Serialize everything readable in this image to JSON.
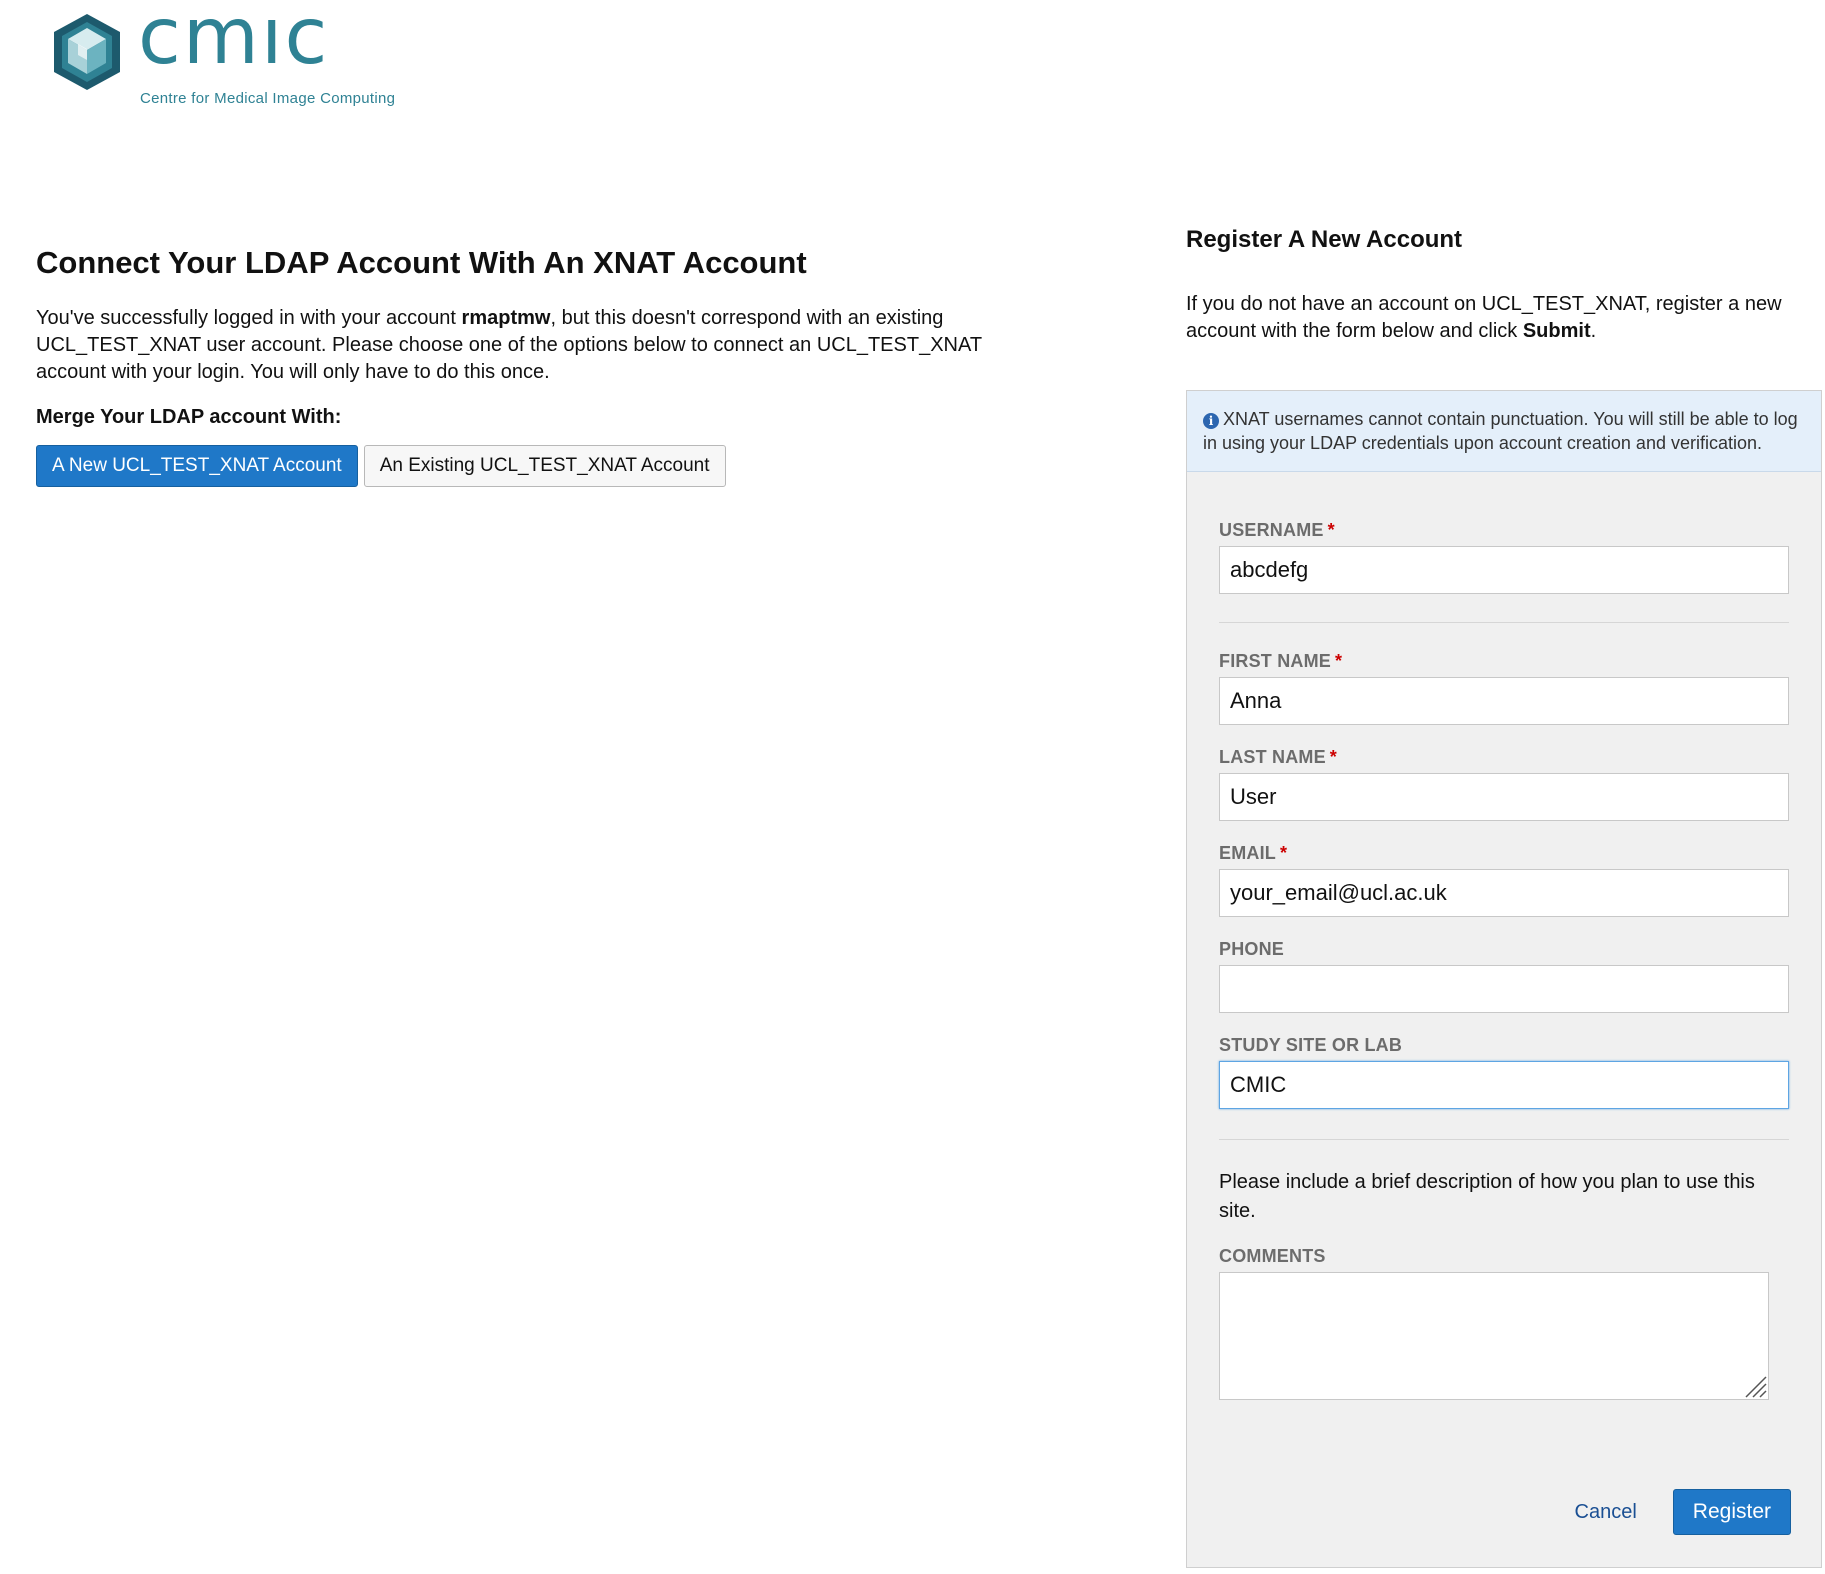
{
  "logo": {
    "wordmark": "cmıc",
    "tagline": "Centre for Medical Image Computing"
  },
  "left": {
    "title": "Connect Your LDAP Account With An XNAT Account",
    "intro_before": "You've successfully logged in with your account ",
    "intro_account": "rmaptmw",
    "intro_after": ", but this doesn't correspond with an existing UCL_TEST_XNAT user account. Please choose one of the options below to connect an UCL_TEST_XNAT account with your login. You will only have to do this once.",
    "merge_heading": "Merge Your LDAP account With:",
    "new_account_button": "A New UCL_TEST_XNAT Account",
    "existing_account_button": "An Existing UCL_TEST_XNAT Account"
  },
  "right": {
    "title": "Register A New Account",
    "desc_before": "If you do not have an account on UCL_TEST_XNAT, register a new account with the form below and click ",
    "desc_submit": "Submit",
    "desc_after": ".",
    "notice": "XNAT usernames cannot contain punctuation. You will still be able to log in using your LDAP credentials upon account creation and verification.",
    "fields": {
      "username": {
        "label": "USERNAME",
        "value": "abcdefg"
      },
      "first_name": {
        "label": "FIRST NAME",
        "value": "Anna"
      },
      "last_name": {
        "label": "LAST NAME",
        "value": "User"
      },
      "email": {
        "label": "EMAIL",
        "value": "your_email@ucl.ac.uk"
      },
      "phone": {
        "label": "PHONE",
        "value": ""
      },
      "site": {
        "label": "STUDY SITE OR LAB",
        "value": "CMIC"
      },
      "comments": {
        "label": "COMMENTS",
        "value": ""
      }
    },
    "required_mark": "*",
    "help_text": "Please include a brief description of how you plan to use this site.",
    "cancel_label": "Cancel",
    "register_label": "Register"
  },
  "colors": {
    "brand": "#2f8294",
    "primary_button": "#1f78c8",
    "required": "#cc0000",
    "notice_bg": "#e4effa",
    "panel_bg": "#f0f0f0"
  },
  "icons": [
    "cmic-cube-logo",
    "info-icon",
    "resize-grip-icon"
  ]
}
